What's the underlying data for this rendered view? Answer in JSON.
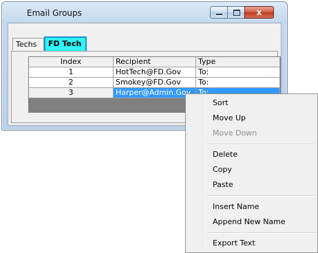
{
  "window": {
    "title": "Email Groups",
    "buttons": {
      "close_glyph": "x"
    }
  },
  "tabs": [
    {
      "label": "Techs",
      "active": false
    },
    {
      "label": "FD Tech",
      "active": true
    }
  ],
  "grid": {
    "columns": [
      "Index",
      "Recipient",
      "Type"
    ],
    "rows": [
      {
        "index": "1",
        "recipient": "HotTech@FD.Gov",
        "type": "To:"
      },
      {
        "index": "2",
        "recipient": "Smokey@FD.Gov",
        "type": "To:"
      },
      {
        "index": "3",
        "recipient": "Harper@Admin.Gov",
        "type": "To:",
        "selected": true
      }
    ]
  },
  "context_menu": {
    "items": [
      {
        "label": "Sort",
        "enabled": true
      },
      {
        "label": "Move Up",
        "enabled": true
      },
      {
        "label": "Move Down",
        "enabled": false
      },
      {
        "label": "Delete",
        "enabled": true
      },
      {
        "label": "Copy",
        "enabled": true
      },
      {
        "label": "Paste",
        "enabled": true
      },
      {
        "label": "Insert Name",
        "enabled": true
      },
      {
        "label": "Append New Name",
        "enabled": true
      },
      {
        "label": "Export Text",
        "enabled": true
      }
    ]
  },
  "colors": {
    "active_tab_bg": "#2ef5f5",
    "selection": "#3399ff",
    "close_button": "#c03a20"
  }
}
